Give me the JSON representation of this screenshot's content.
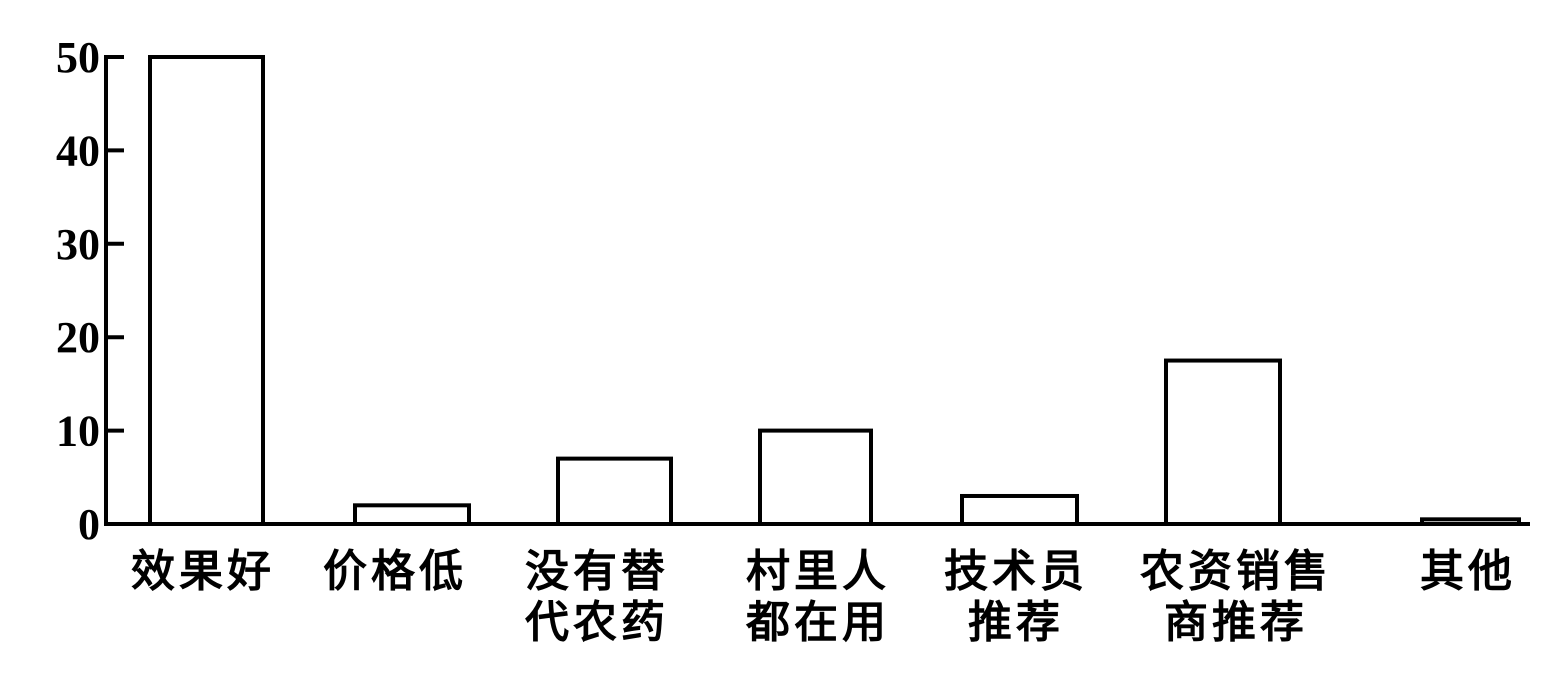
{
  "chart_data": {
    "type": "bar",
    "categories": [
      [
        "效果好"
      ],
      [
        "价格低"
      ],
      [
        "没有替",
        "代农药"
      ],
      [
        "村里人",
        "都在用"
      ],
      [
        "技术员",
        "推荐"
      ],
      [
        "农资销售",
        "商推荐"
      ],
      [
        "其他"
      ]
    ],
    "values": [
      50,
      2,
      7,
      10,
      3,
      17.5,
      0.5
    ],
    "yticks": [
      0,
      10,
      20,
      30,
      40,
      50
    ],
    "ylim": [
      0,
      50
    ],
    "title": "",
    "xlabel": "",
    "ylabel": "",
    "grid": false,
    "bar_color": "#ffffff",
    "line_color": "#000000"
  }
}
